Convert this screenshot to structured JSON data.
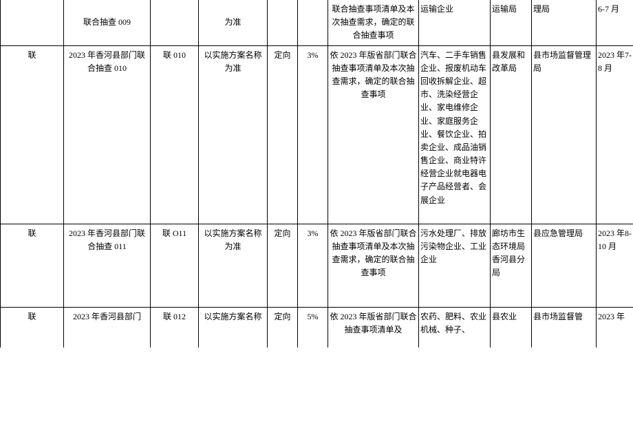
{
  "rows": [
    {
      "c1": "",
      "c2": "联合抽查 009",
      "c3": "",
      "c4": "为准",
      "c5": "",
      "c6": "",
      "c7": "联合抽查事项清单及本次抽查需求，确定的联合抽查事项",
      "c8": "运输企业",
      "c9": "运输局",
      "c10": "理局",
      "c11": "6-7 月"
    },
    {
      "c1": "联",
      "c2": "2023 年香河县部门联合抽查 010",
      "c3": "联 010",
      "c4": "以实施方案名称为准",
      "c5": "定向",
      "c6": "3%",
      "c7": "依 2023 年版省部门联合抽查事项清单及本次抽查需求，确定的联合抽查事项",
      "c8": "汽车、二手车销售企业、报废机动车回收拆解企业、超市、洗染经营企业、家电维修企业、家庭服务企业、餐饮企业、拍卖企业、成品油销售企业、商业特许经营企业就电器电子产品经营者、会展企业",
      "c9": "县发展和改革局",
      "c10": "县市场监督管理局",
      "c11": "2023 年7-8 月"
    },
    {
      "c1": "联",
      "c2": "2023 年香河县部门联合抽查 011",
      "c3": "联 O11",
      "c4": "以实施方案名称为准",
      "c5": "定向",
      "c6": "3%",
      "c7": "依 2023 年版省部门联合抽查事项清单及本次抽查需求，确定的联合抽查事项",
      "c8": "污水处理厂、排放污染物企业、工业企业",
      "c9": "廊坊市生态环境局香河县分局",
      "c10": "县应急管理局",
      "c11": "2023 年8-10 月"
    },
    {
      "c1": "联",
      "c2": "2023 年香河县部门",
      "c3": "联 012",
      "c4": "以实施方案名称",
      "c5": "定向",
      "c6": "5%",
      "c7": "依 2023 年版省部门联合抽查事项清单及",
      "c8": "农药、肥料、农业机械、种子、",
      "c9": "县农业",
      "c10": "县市场监督管",
      "c11": "2023 年"
    }
  ]
}
